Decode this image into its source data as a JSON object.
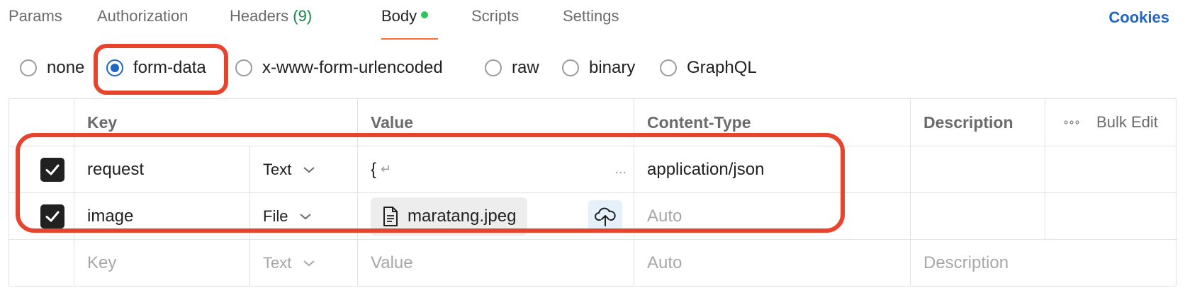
{
  "tabs": [
    {
      "label": "Params"
    },
    {
      "label": "Authorization"
    },
    {
      "label": "Headers",
      "count": "(9)"
    },
    {
      "label": "Body",
      "active": true
    },
    {
      "label": "Scripts"
    },
    {
      "label": "Settings"
    }
  ],
  "cookies_label": "Cookies",
  "body_types": [
    {
      "label": "none",
      "checked": false
    },
    {
      "label": "form-data",
      "checked": true
    },
    {
      "label": "x-www-form-urlencoded",
      "checked": false
    },
    {
      "label": "raw",
      "checked": false
    },
    {
      "label": "binary",
      "checked": false
    },
    {
      "label": "GraphQL",
      "checked": false
    }
  ],
  "table": {
    "headers": {
      "key": "Key",
      "value": "Value",
      "content_type": "Content-Type",
      "description": "Description",
      "bulk_edit": "Bulk Edit",
      "more_icon": "∘∘∘"
    },
    "rows": [
      {
        "checked": true,
        "key": "request",
        "type": "Text",
        "value": "{",
        "value_newline_icon": "↵",
        "value_ellipsis": "...",
        "content_type": "application/json"
      },
      {
        "checked": true,
        "key": "image",
        "type": "File",
        "file_name": "maratang.jpeg",
        "content_type_placeholder": "Auto"
      }
    ],
    "new_row": {
      "key_placeholder": "Key",
      "type": "Text",
      "value_placeholder": "Value",
      "content_type_placeholder": "Auto",
      "description_placeholder": "Description"
    }
  },
  "colors": {
    "accent": "#1f66c5",
    "active_dot": "#2ec55c",
    "tab_underline": "#ff6c37",
    "highlight": "#e8432d",
    "headers_count": "#0f8a43"
  }
}
